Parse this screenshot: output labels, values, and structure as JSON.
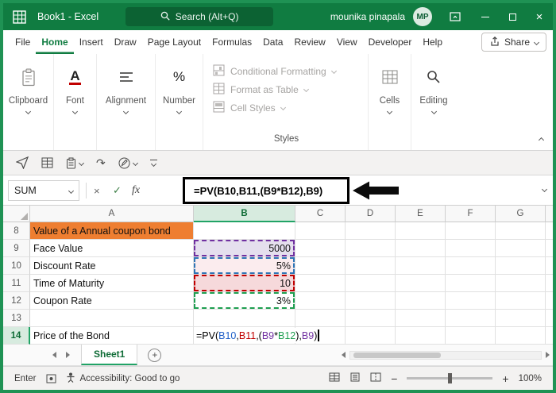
{
  "window": {
    "title": "Book1  -  Excel",
    "search_placeholder": "Search (Alt+Q)",
    "user_name": "mounika pinapala",
    "user_initials": "MP"
  },
  "ribbon": {
    "tabs": [
      "File",
      "Home",
      "Insert",
      "Draw",
      "Page Layout",
      "Formulas",
      "Data",
      "Review",
      "View",
      "Developer",
      "Help"
    ],
    "active_tab": "Home",
    "share_label": "Share",
    "groups": {
      "clipboard": "Clipboard",
      "font": "Font",
      "alignment": "Alignment",
      "number": "Number",
      "styles": "Styles",
      "styles_items": [
        "Conditional Formatting",
        "Format as Table",
        "Cell Styles"
      ],
      "cells": "Cells",
      "editing": "Editing"
    }
  },
  "formula_bar": {
    "name_box": "SUM",
    "fx_label": "fx",
    "formula": "=PV(B10,B11,(B9*B12),B9)"
  },
  "icons": {
    "cancel": "×",
    "enter": "✓",
    "redo": "↷",
    "font": "A",
    "percent": "%",
    "plus": "+",
    "minus": "−",
    "add_sheet": "+"
  },
  "sheet": {
    "columns": [
      "A",
      "B",
      "C",
      "D",
      "E",
      "F",
      "G"
    ],
    "rows": [
      {
        "num": "8",
        "a": "Value of a Annual coupon bond",
        "b": ""
      },
      {
        "num": "9",
        "a": "Face Value",
        "b": "5000"
      },
      {
        "num": "10",
        "a": "Discount Rate",
        "b": "5%"
      },
      {
        "num": "11",
        "a": "Time of Maturity",
        "b": "10"
      },
      {
        "num": "12",
        "a": "Coupon Rate",
        "b": "3%"
      },
      {
        "num": "13",
        "a": "",
        "b": ""
      },
      {
        "num": "14",
        "a": "Price of the Bond",
        "b": ""
      }
    ],
    "b14_formula_segments": [
      {
        "text": "=PV(",
        "color": "#000000"
      },
      {
        "text": "B10",
        "color": "#1E5EC8"
      },
      {
        "text": ",",
        "color": "#000000"
      },
      {
        "text": "B11",
        "color": "#C00000"
      },
      {
        "text": ",(",
        "color": "#000000"
      },
      {
        "text": "B9",
        "color": "#7030A0"
      },
      {
        "text": "*",
        "color": "#000000"
      },
      {
        "text": "B12",
        "color": "#1E9E50"
      },
      {
        "text": "),",
        "color": "#000000"
      },
      {
        "text": "B9",
        "color": "#7030A0"
      },
      {
        "text": ")",
        "color": "#000000"
      }
    ],
    "tab_name": "Sheet1"
  },
  "status_bar": {
    "mode": "Enter",
    "accessibility": "Accessibility: Good to go",
    "zoom_level": "100%"
  },
  "colors": {
    "excel_green": "#107C41",
    "selection_accent": "#21A366",
    "cell_fill_orange": "#EE7E31",
    "cell_fill_lavender": "#E5DFEE",
    "cell_fill_pink_light": "#FBECEE",
    "cell_fill_pink": "#F6D9DB"
  }
}
